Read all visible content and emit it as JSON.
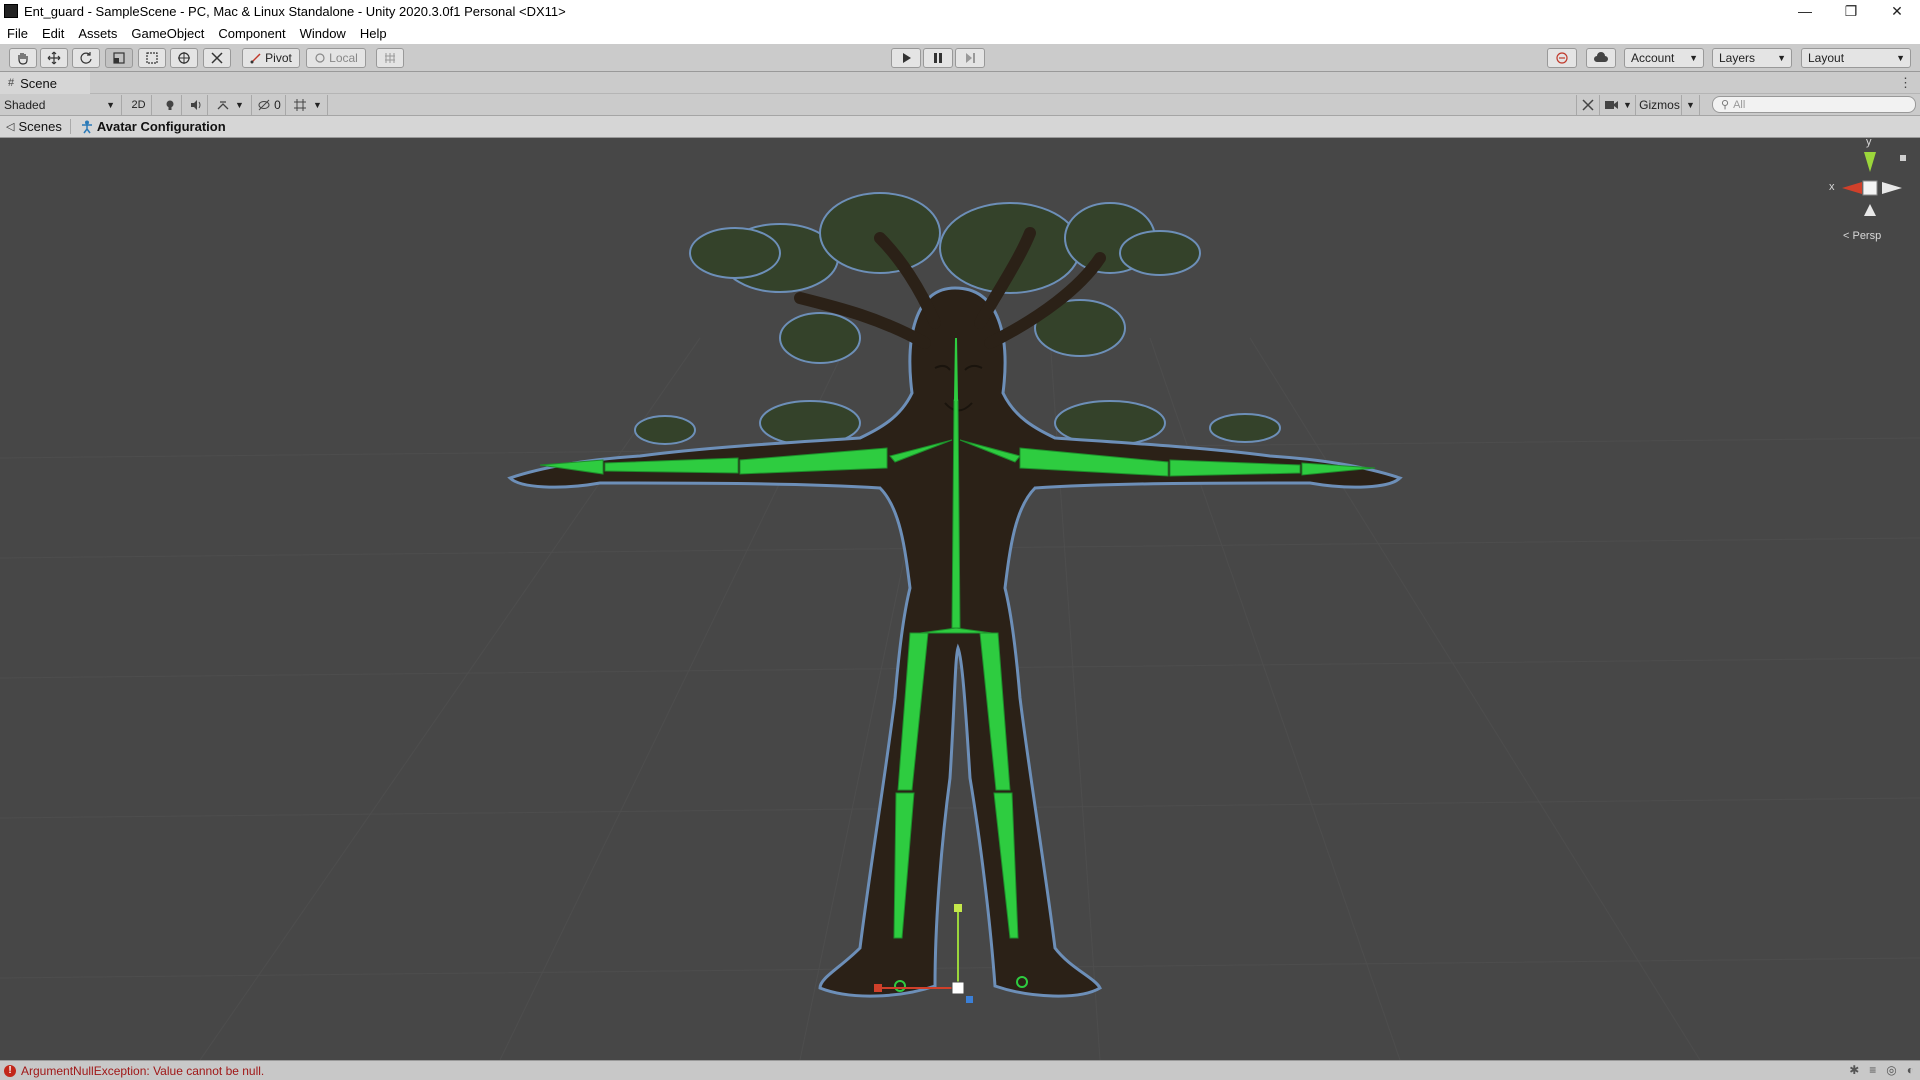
{
  "window": {
    "title": "Ent_guard - SampleScene - PC, Mac & Linux Standalone - Unity 2020.3.0f1 Personal <DX11>",
    "minimize_glyph": "—",
    "maximize_glyph": "❐",
    "close_glyph": "✕"
  },
  "menu": [
    "File",
    "Edit",
    "Assets",
    "GameObject",
    "Component",
    "Window",
    "Help"
  ],
  "toolbar": {
    "pivot_label": "Pivot",
    "local_label": "Local",
    "account_label": "Account",
    "layers_label": "Layers",
    "layout_label": "Layout"
  },
  "scene_tab": {
    "label": "Scene"
  },
  "scene_toolbar": {
    "shading_mode": "Shaded",
    "mode_2d": "2D",
    "hidden_count": "0",
    "gizmos_label": "Gizmos",
    "search_placeholder": "All"
  },
  "breadcrumb": {
    "scenes_label": "Scenes",
    "current_label": "Avatar Configuration"
  },
  "viewport": {
    "gizmo_y": "y",
    "gizmo_x": "x",
    "projection_label": "< Persp",
    "bone_color": "#2ecc40",
    "outline_color": "#6d8fb8",
    "bark_color": "#2b2117",
    "foliage_color": "#3a4a2a"
  },
  "status": {
    "message": "ArgumentNullException: Value cannot be null.",
    "error_color": "#c2271a"
  }
}
